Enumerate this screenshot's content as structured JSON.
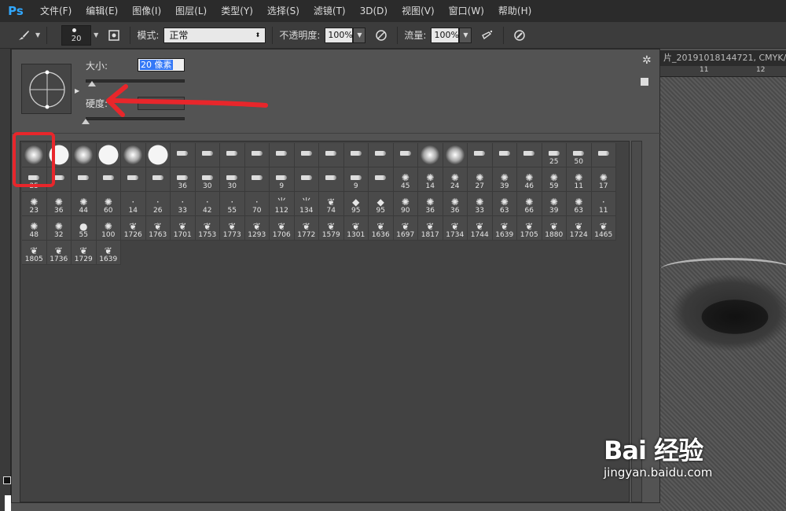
{
  "app": {
    "logo": "Ps"
  },
  "menu": [
    "文件(F)",
    "编辑(E)",
    "图像(I)",
    "图层(L)",
    "类型(Y)",
    "选择(S)",
    "滤镜(T)",
    "3D(D)",
    "视图(V)",
    "窗口(W)",
    "帮助(H)"
  ],
  "options": {
    "brush_size": "20",
    "mode_label": "模式:",
    "mode_value": "正常",
    "opacity_label": "不透明度:",
    "opacity_value": "100%",
    "flow_label": "流量:",
    "flow_value": "100%"
  },
  "doc": {
    "tab_title": "片_20191018144721, CMYK/",
    "ruler_ticks": [
      "11",
      "12"
    ]
  },
  "panel": {
    "size_label": "大小:",
    "size_value": "20 像素",
    "hardness_label": "硬度:",
    "size_slider": 0.06,
    "hardness_slider": 0.0
  },
  "brushes": [
    {
      "t": "soft",
      "n": ""
    },
    {
      "t": "hard",
      "n": ""
    },
    {
      "t": "soft",
      "n": ""
    },
    {
      "t": "hard",
      "n": ""
    },
    {
      "t": "soft",
      "n": ""
    },
    {
      "t": "hard",
      "n": ""
    },
    {
      "t": "tip",
      "n": ""
    },
    {
      "t": "tip",
      "n": ""
    },
    {
      "t": "tip",
      "n": ""
    },
    {
      "t": "tip",
      "n": ""
    },
    {
      "t": "tip",
      "n": ""
    },
    {
      "t": "tip",
      "n": ""
    },
    {
      "t": "tip",
      "n": ""
    },
    {
      "t": "tip",
      "n": ""
    },
    {
      "t": "tip",
      "n": ""
    },
    {
      "t": "tip",
      "n": ""
    },
    {
      "t": "soft",
      "n": ""
    },
    {
      "t": "soft",
      "n": ""
    },
    {
      "t": "tip",
      "n": ""
    },
    {
      "t": "tip",
      "n": ""
    },
    {
      "t": "tip",
      "n": ""
    },
    {
      "t": "tip",
      "n": "25"
    },
    {
      "t": "tip",
      "n": "50"
    },
    {
      "t": "tip",
      "n": ""
    },
    {
      "t": "tip",
      "n": "25"
    },
    {
      "t": "tip",
      "n": ""
    },
    {
      "t": "tip",
      "n": ""
    },
    {
      "t": "tip",
      "n": ""
    },
    {
      "t": "tip",
      "n": ""
    },
    {
      "t": "tip",
      "n": ""
    },
    {
      "t": "tip",
      "n": "36"
    },
    {
      "t": "tip",
      "n": "30"
    },
    {
      "t": "tip",
      "n": "30"
    },
    {
      "t": "tip",
      "n": ""
    },
    {
      "t": "tip",
      "n": "9"
    },
    {
      "t": "tip",
      "n": ""
    },
    {
      "t": "tip",
      "n": ""
    },
    {
      "t": "tip",
      "n": "9"
    },
    {
      "t": "tip",
      "n": ""
    },
    {
      "t": "splat",
      "n": "45"
    },
    {
      "t": "splat",
      "n": "14"
    },
    {
      "t": "splat",
      "n": "24"
    },
    {
      "t": "splat",
      "n": "27"
    },
    {
      "t": "splat",
      "n": "39"
    },
    {
      "t": "splat",
      "n": "46"
    },
    {
      "t": "splat",
      "n": "59"
    },
    {
      "t": "splat",
      "n": "11"
    },
    {
      "t": "splat",
      "n": "17"
    },
    {
      "t": "splat",
      "n": "23"
    },
    {
      "t": "splat",
      "n": "36"
    },
    {
      "t": "splat",
      "n": "44"
    },
    {
      "t": "splat",
      "n": "60"
    },
    {
      "t": "dot",
      "n": "14"
    },
    {
      "t": "dot",
      "n": "26"
    },
    {
      "t": "dot",
      "n": "33"
    },
    {
      "t": "dot",
      "n": "42"
    },
    {
      "t": "dot",
      "n": "55"
    },
    {
      "t": "dot",
      "n": "70"
    },
    {
      "t": "grass",
      "n": "112"
    },
    {
      "t": "grass",
      "n": "134"
    },
    {
      "t": "leaf",
      "n": "74"
    },
    {
      "t": "drop",
      "n": "95"
    },
    {
      "t": "drop",
      "n": "95"
    },
    {
      "t": "splat",
      "n": "90"
    },
    {
      "t": "splat",
      "n": "36"
    },
    {
      "t": "splat",
      "n": "36"
    },
    {
      "t": "splat",
      "n": "33"
    },
    {
      "t": "splat",
      "n": "63"
    },
    {
      "t": "splat",
      "n": "66"
    },
    {
      "t": "splat",
      "n": "39"
    },
    {
      "t": "splat",
      "n": "63"
    },
    {
      "t": "dot",
      "n": "11"
    },
    {
      "t": "splat",
      "n": "48"
    },
    {
      "t": "splat",
      "n": "32"
    },
    {
      "t": "circle",
      "n": "55"
    },
    {
      "t": "splat",
      "n": "100"
    },
    {
      "t": "leaf",
      "n": "1726"
    },
    {
      "t": "leaf",
      "n": "1763"
    },
    {
      "t": "leaf",
      "n": "1701"
    },
    {
      "t": "leaf",
      "n": "1753"
    },
    {
      "t": "leaf",
      "n": "1773"
    },
    {
      "t": "leaf",
      "n": "1293"
    },
    {
      "t": "leaf",
      "n": "1706"
    },
    {
      "t": "leaf",
      "n": "1772"
    },
    {
      "t": "leaf",
      "n": "1579"
    },
    {
      "t": "leaf",
      "n": "1301"
    },
    {
      "t": "leaf",
      "n": "1636"
    },
    {
      "t": "leaf",
      "n": "1697"
    },
    {
      "t": "leaf",
      "n": "1817"
    },
    {
      "t": "leaf",
      "n": "1734"
    },
    {
      "t": "leaf",
      "n": "1744"
    },
    {
      "t": "leaf",
      "n": "1639"
    },
    {
      "t": "leaf",
      "n": "1705"
    },
    {
      "t": "leaf",
      "n": "1880"
    },
    {
      "t": "leaf",
      "n": "1724"
    },
    {
      "t": "leaf",
      "n": "1465"
    },
    {
      "t": "leaf",
      "n": "1805"
    },
    {
      "t": "leaf",
      "n": "1736"
    },
    {
      "t": "leaf",
      "n": "1729"
    },
    {
      "t": "leaf",
      "n": "1639"
    }
  ],
  "watermark": {
    "logo": "Bai 经验",
    "url": "jingyan.baidu.com"
  },
  "colors": {
    "annotation": "#e8262b",
    "ps_blue": "#31a8ff"
  }
}
